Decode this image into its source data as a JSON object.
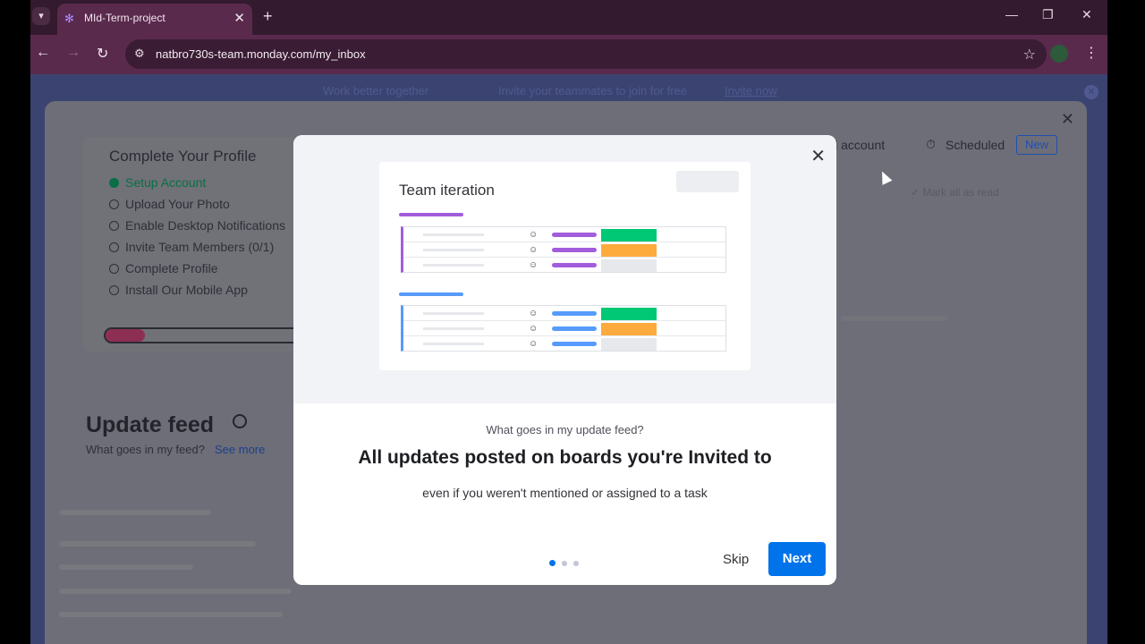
{
  "browser": {
    "tab_title": "MId-Term-project",
    "url": "natbro730s-team.monday.com/my_inbox"
  },
  "banner": {
    "text1": "Work better together",
    "text2": "Invite your teammates to join for free",
    "link": "Invite now"
  },
  "profile": {
    "title": "Complete Your Profile",
    "steps": [
      {
        "label": "Setup Account",
        "done": true
      },
      {
        "label": "Upload Your Photo",
        "done": false
      },
      {
        "label": "Enable Desktop Notifications",
        "done": false
      },
      {
        "label": "Invite Team Members (0/1)",
        "done": false
      },
      {
        "label": "Complete Profile",
        "done": false
      },
      {
        "label": "Install Our Mobile App",
        "done": false
      }
    ],
    "progress": 0.17
  },
  "feed": {
    "title": "Update feed",
    "subtitle": "What goes in my feed?",
    "link": "See more"
  },
  "right_panel": {
    "all_account": "ll account",
    "scheduled": "Scheduled",
    "new_badge": "New",
    "mark_all_read": "Mark all as read"
  },
  "modal": {
    "illustration_title": "Team iteration",
    "subtitle": "What goes in my update feed?",
    "title": "All updates posted on boards you're Invited to",
    "description": "even if you weren't mentioned or assigned to a task",
    "skip_label": "Skip",
    "next_label": "Next",
    "page_count": 3,
    "active_page": 1
  },
  "colors": {
    "accent": "#0073ea",
    "purple": "#a25ddc",
    "blue": "#579bfc",
    "green": "#00c875",
    "orange": "#fdab3d"
  }
}
